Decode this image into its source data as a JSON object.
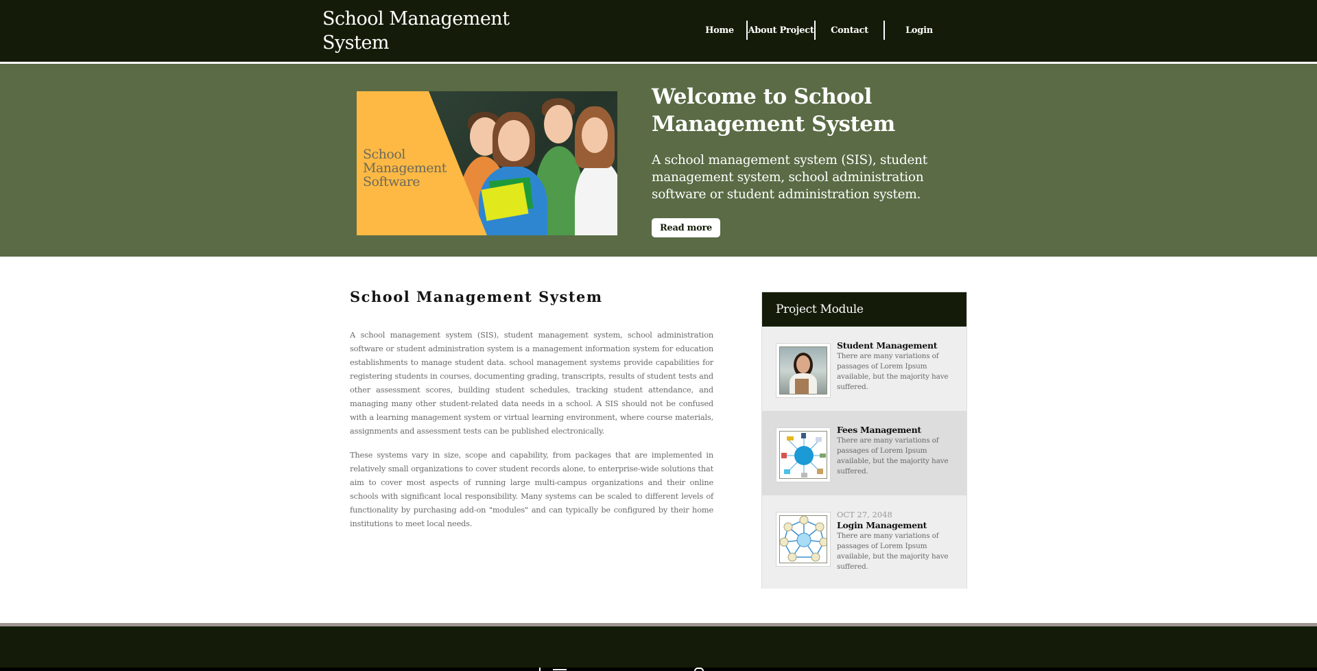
{
  "header": {
    "logo": "School Management System",
    "nav": [
      {
        "label": "Home"
      },
      {
        "label": "About Project"
      },
      {
        "label": "Contact"
      },
      {
        "label": "Login"
      }
    ]
  },
  "hero": {
    "image_text": [
      "School",
      "Management",
      "Software"
    ],
    "title": "Welcome to School Management System",
    "text": "A school management system (SIS), student management system, school administration software or student administration system.",
    "button": "Read more"
  },
  "main": {
    "title": "School Management System",
    "paragraphs": [
      "A school management system (SIS), student management system, school administration software or student administration system is a management information system for education establishments to manage student data. school management systems provide capabilities for registering students in courses, documenting grading, transcripts, results of student tests and other assessment scores, building student schedules, tracking student attendance, and managing many other student-related data needs in a school. A SIS should not be confused with a learning management system or virtual learning environment, where course materials, assignments and assessment tests can be published electronically.",
      "These systems vary in size, scope and capability, from packages that are implemented in relatively small organizations to cover student records alone, to enterprise-wide solutions that aim to cover most aspects of running large multi-campus organizations and their online schools with significant local responsibility. Many systems can be scaled to different levels of functionality by purchasing add-on \"modules\" and can typically be configured by their home institutions to meet local needs."
    ]
  },
  "sidebar": {
    "title": "Project Module",
    "modules": [
      {
        "date": "",
        "title": "Student Management",
        "desc": "There are many variations of passages of Lorem Ipsum available, but the majority have suffered.",
        "icon": "student-photo-icon"
      },
      {
        "date": "",
        "title": "Fees Management",
        "desc": "There are many variations of passages of Lorem Ipsum available, but the majority have suffered.",
        "icon": "fees-diagram-icon"
      },
      {
        "date": "OCT 27, 2048",
        "title": "Login Management",
        "desc": "There are many variations of passages of Lorem Ipsum available, but the majority have suffered.",
        "icon": "login-diagram-icon"
      }
    ]
  },
  "colors": {
    "header_bg": "#141c09",
    "hero_bg": "#5a6b45",
    "hero_image_yellow": "#fdb944",
    "panel_bg": "#eeeeee",
    "panel_alt_bg": "#dddddd",
    "footer_line": "#a09592"
  }
}
